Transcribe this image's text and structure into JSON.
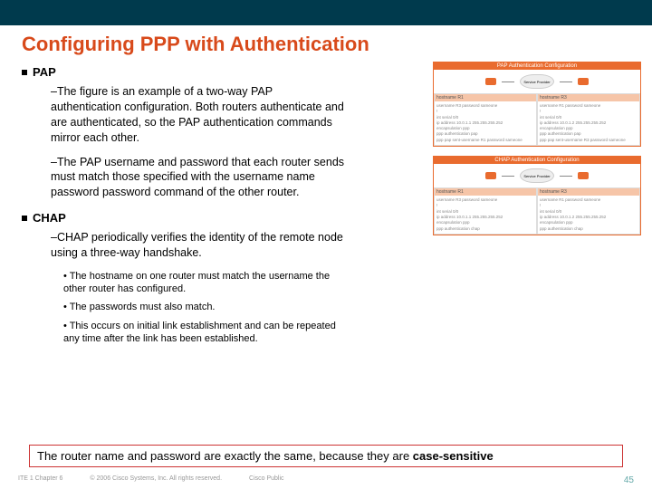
{
  "title": "Configuring PPP with Authentication",
  "pap": {
    "heading": "PAP",
    "p1": "–The figure is an example of a two-way PAP authentication configuration. Both routers authenticate and are authenticated, so the PAP authentication commands mirror each other.",
    "p2": "–The PAP username and password that each router sends must match those specified with the username name password password command of the other router."
  },
  "chap": {
    "heading": "CHAP",
    "p1": "–CHAP periodically verifies the identity of the remote node using a three-way handshake.",
    "b1": "• The hostname on one router must match the username the other router has configured.",
    "b2": "• The passwords must also match.",
    "b3": "• This occurs on initial link establishment and can be repeated any time after the link has been established."
  },
  "fig1": {
    "title": "PAP Authentication Configuration",
    "cloud": "Service Provider",
    "r1": "R1",
    "r3": "R3",
    "c1h": "hostname R1",
    "c1": "username R3 password sameone\n!\nint serial 0/0\nip address 10.0.1.1 255.255.255.252\nencapsulation ppp\nppp authentication pap\nppp pap sent-username R1 password sameone",
    "c2h": "hostname R3",
    "c2": "username R1 password sameone\n!\nint serial 0/0\nip address 10.0.1.2 255.255.255.252\nencapsulation ppp\nppp authentication pap\nppp pap sent-username R3 password sameone"
  },
  "fig2": {
    "title": "CHAP Authentication Configuration",
    "cloud": "Service Provider",
    "c1h": "hostname R1",
    "c1": "username R3 password sameone\n!\nint serial 0/0\nip address 10.0.1.1 255.255.255.252\nencapsulation ppp\nppp authentication chap",
    "c2h": "hostname R3",
    "c2": "username R1 password sameone\n!\nint serial 0/0\nip address 10.0.1.2 255.255.255.252\nencapsulation ppp\nppp authentication chap"
  },
  "callout": {
    "pre": "The router name and password are exactly the same, because they are ",
    "strong": "case-sensitive"
  },
  "footer": {
    "left": "ITE 1 Chapter 6",
    "mid": "© 2006 Cisco Systems, Inc. All rights reserved.",
    "right": "Cisco Public",
    "page": "45"
  }
}
